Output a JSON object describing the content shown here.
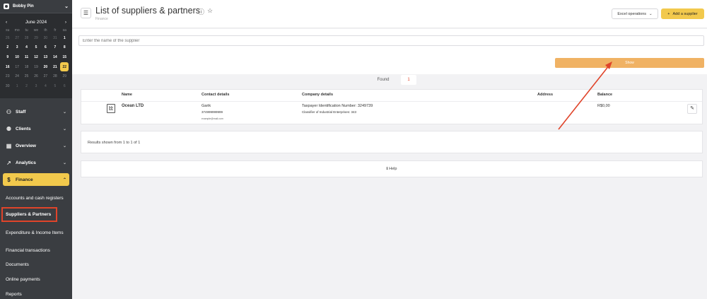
{
  "sidebar": {
    "user_name": "Bobby Pin",
    "calendar": {
      "month_label": "June 2024",
      "prev": "‹",
      "next": "›",
      "day_names": [
        "su",
        "mo",
        "tu",
        "we",
        "th",
        "fr",
        "sa"
      ],
      "weeks": [
        [
          {
            "d": "26",
            "s": "faded"
          },
          {
            "d": "27",
            "s": "faded"
          },
          {
            "d": "28",
            "s": "faded"
          },
          {
            "d": "29",
            "s": "faded"
          },
          {
            "d": "30",
            "s": "faded"
          },
          {
            "d": "31",
            "s": "faded"
          },
          {
            "d": "1",
            "s": "norm"
          }
        ],
        [
          {
            "d": "2",
            "s": "norm"
          },
          {
            "d": "3",
            "s": "norm"
          },
          {
            "d": "4",
            "s": "norm"
          },
          {
            "d": "5",
            "s": "norm"
          },
          {
            "d": "6",
            "s": "norm"
          },
          {
            "d": "7",
            "s": "norm"
          },
          {
            "d": "8",
            "s": "norm"
          }
        ],
        [
          {
            "d": "9",
            "s": "norm"
          },
          {
            "d": "10",
            "s": "norm"
          },
          {
            "d": "11",
            "s": "norm"
          },
          {
            "d": "12",
            "s": "norm"
          },
          {
            "d": "13",
            "s": "norm"
          },
          {
            "d": "14",
            "s": "norm"
          },
          {
            "d": "15",
            "s": "norm"
          }
        ],
        [
          {
            "d": "16",
            "s": "norm"
          },
          {
            "d": "17",
            "s": "future"
          },
          {
            "d": "18",
            "s": "future"
          },
          {
            "d": "19",
            "s": "future"
          },
          {
            "d": "20",
            "s": "norm"
          },
          {
            "d": "21",
            "s": "norm"
          },
          {
            "d": "22",
            "s": "today"
          }
        ],
        [
          {
            "d": "23",
            "s": "future"
          },
          {
            "d": "24",
            "s": "future"
          },
          {
            "d": "25",
            "s": "future"
          },
          {
            "d": "26",
            "s": "future"
          },
          {
            "d": "27",
            "s": "future"
          },
          {
            "d": "28",
            "s": "future"
          },
          {
            "d": "29",
            "s": "future"
          }
        ],
        [
          {
            "d": "30",
            "s": "future"
          },
          {
            "d": "1",
            "s": "faded"
          },
          {
            "d": "2",
            "s": "faded"
          },
          {
            "d": "3",
            "s": "faded"
          },
          {
            "d": "4",
            "s": "faded"
          },
          {
            "d": "5",
            "s": "faded"
          },
          {
            "d": "6",
            "s": "faded"
          }
        ]
      ]
    },
    "nav": {
      "staff": "Staff",
      "clients": "Clients",
      "overview": "Overview",
      "analytics": "Analytics",
      "finance": "Finance"
    },
    "finance_sub": {
      "accounts": "Accounts and cash registers",
      "suppliers": "Suppliers & Partners",
      "expenditure": "Expenditure & Income Items",
      "transactions": "Financial transactions",
      "documents": "Documents",
      "online_payments": "Online payments",
      "reports": "Reports"
    }
  },
  "header": {
    "title": "List of suppliers & partners",
    "breadcrumb": "Finance",
    "excel_label": "Excel operations",
    "add_label": "Add a supplier"
  },
  "filter": {
    "search_placeholder": "Enter the name of the supplier",
    "show_label": "Show"
  },
  "found": {
    "label": "Found",
    "count": "1"
  },
  "table": {
    "headers": {
      "name": "Name",
      "contact": "Contact details",
      "company": "Company details",
      "address": "Address",
      "balance": "Balance"
    },
    "rows": [
      {
        "name": "Ocean LTD",
        "contact_name": "Garik",
        "contact_phone": "374999999999",
        "contact_email": "example@mail.com",
        "tin": "Taxpayer Identification Number: 3249739",
        "classifier": "Classifier of Industrial Enterprises: 343",
        "address": "",
        "balance": "R$0,00"
      }
    ]
  },
  "results_text": "Results shown from 1 to 1 of 1",
  "help_label": "Help",
  "colors": {
    "accent": "#f2c94c",
    "show_button": "#f0b264",
    "annotation": "#e0442a",
    "sidebar": "#3a3d41"
  }
}
